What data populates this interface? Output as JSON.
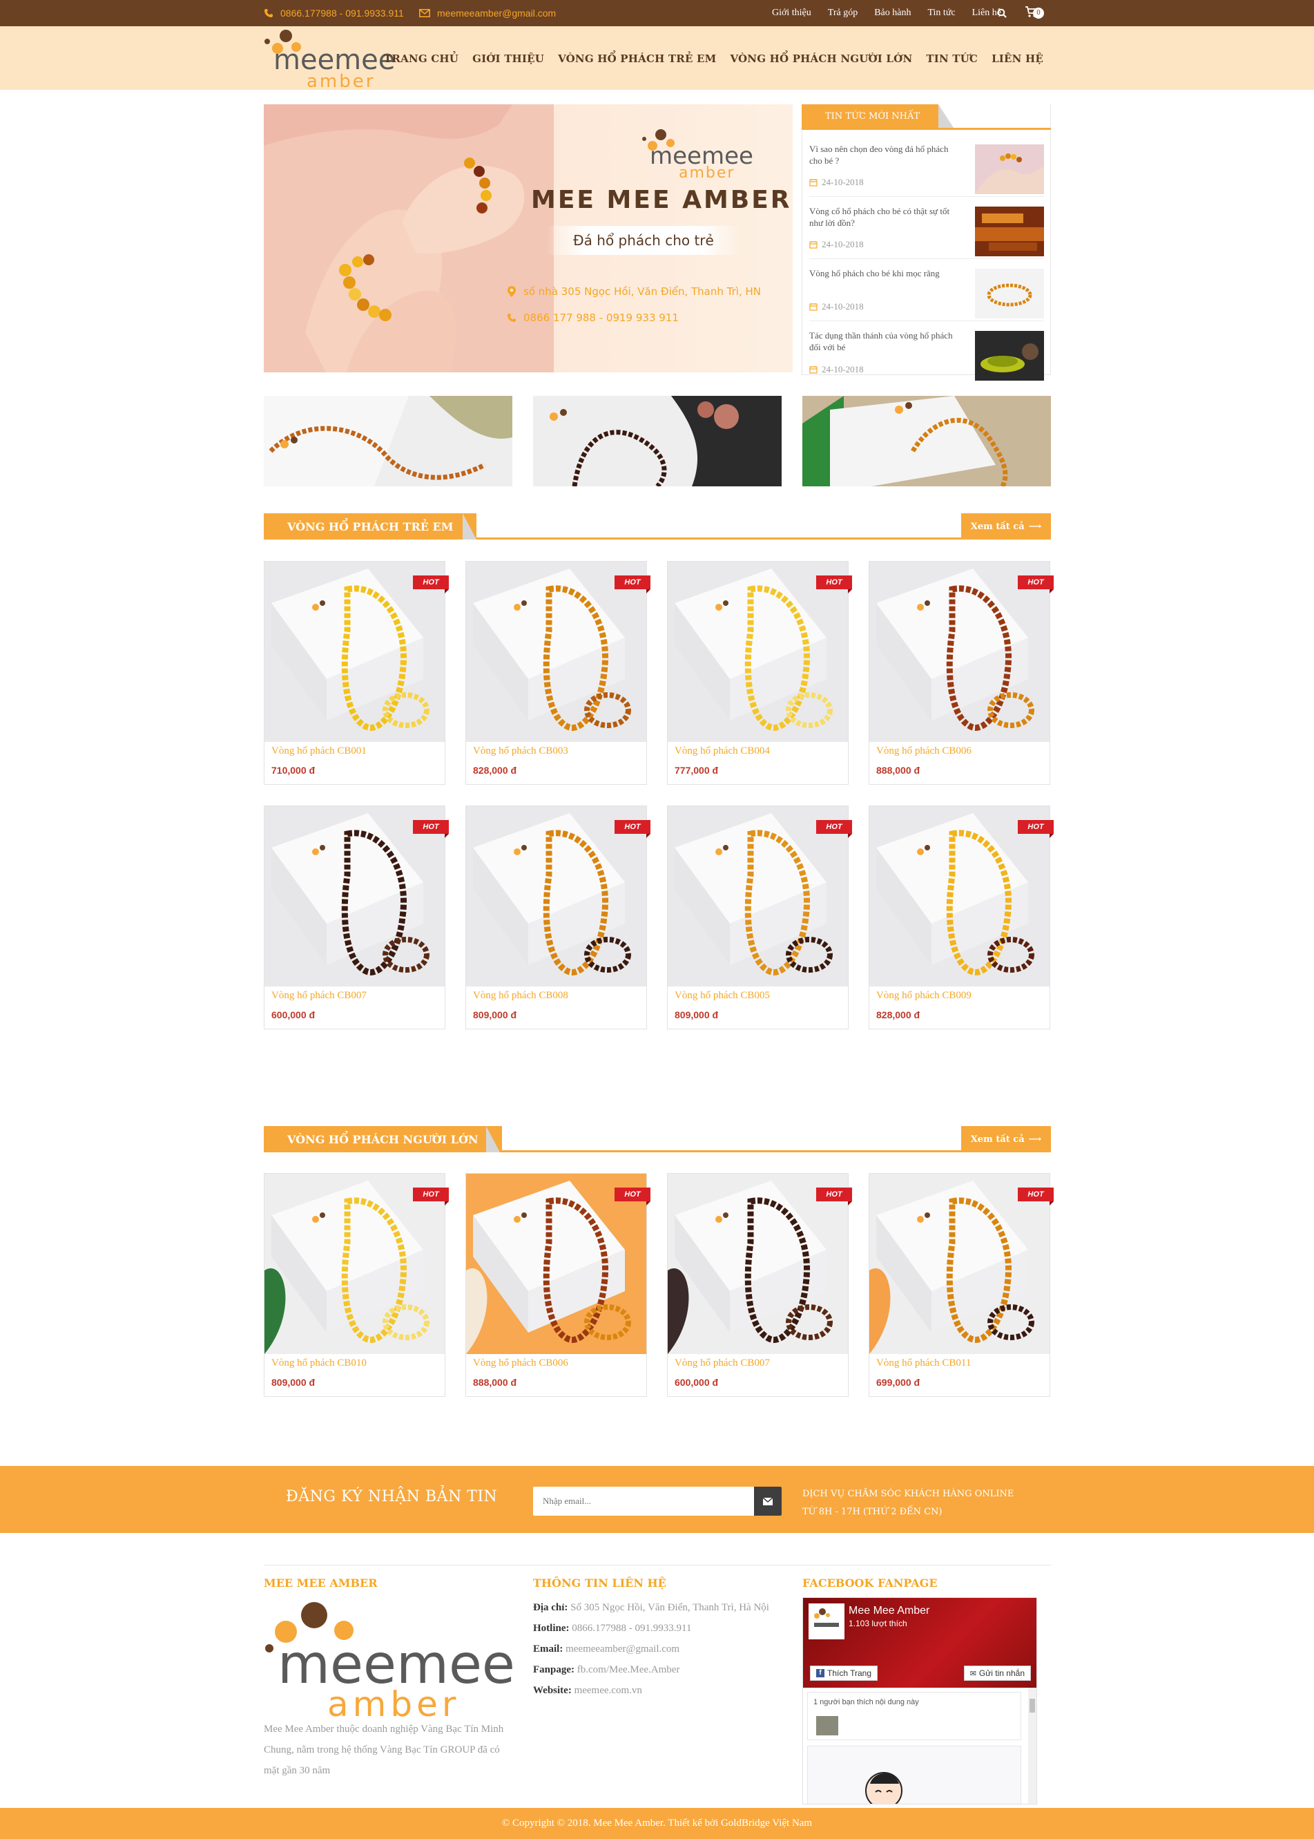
{
  "topbar": {
    "phone": "0866.177988 - 091.9933.911",
    "email": "meemeeamber@gmail.com",
    "links": [
      "Giới thiệu",
      "Trả góp",
      "Bảo hành",
      "Tin tức",
      "Liên hệ"
    ],
    "cart_count": "0"
  },
  "logo": {
    "line1": "meemee",
    "line2": "amber"
  },
  "nav": [
    "TRANG CHỦ",
    "GIỚI THIỆU",
    "VÒNG HỔ PHÁCH TRẺ EM",
    "VÒNG HỔ PHÁCH NGƯỜI LỚN",
    "TIN TỨC",
    "LIÊN HỆ"
  ],
  "banner": {
    "logo_line1": "meemee",
    "logo_line2": "amber",
    "title": "MEE MEE AMBER",
    "subtitle": "Đá hổ phách cho trẻ",
    "address": "số nhà 305 Ngọc Hồi, Văn Điển, Thanh Trì, HN",
    "phone": "0866 177 988 - 0919 933 911"
  },
  "news": {
    "heading": "TIN TỨC MỚI NHẤT",
    "items": [
      {
        "title": "Vì sao nên chọn đeo vòng đá hổ phách cho bé ?",
        "date": "24-10-2018"
      },
      {
        "title": "Vòng cổ hổ phách cho bé có thật sự tốt như lời đồn?",
        "date": "24-10-2018"
      },
      {
        "title": "Vòng hổ phách cho bé khi mọc răng",
        "date": "24-10-2018"
      },
      {
        "title": "Tác dụng thần thánh của vòng hổ phách đối với bé",
        "date": "24-10-2018"
      }
    ]
  },
  "section_kids": {
    "title": "VÒNG HỔ PHÁCH TRẺ EM",
    "more": "Xem tất cả",
    "products": [
      {
        "name": "Vòng hổ phách CB001",
        "price": "710,000 đ",
        "badge": "HOT"
      },
      {
        "name": "Vòng hổ phách CB003",
        "price": "828,000 đ",
        "badge": "HOT"
      },
      {
        "name": "Vòng hổ phách CB004",
        "price": "777,000 đ",
        "badge": "HOT"
      },
      {
        "name": "Vòng hổ phách CB006",
        "price": "888,000 đ",
        "badge": "HOT"
      },
      {
        "name": "Vòng hổ phách CB007",
        "price": "600,000 đ",
        "badge": "HOT"
      },
      {
        "name": "Vòng hổ phách CB008",
        "price": "809,000 đ",
        "badge": "HOT"
      },
      {
        "name": "Vòng hổ phách CB005",
        "price": "809,000 đ",
        "badge": "HOT"
      },
      {
        "name": "Vòng hổ phách CB009",
        "price": "828,000 đ",
        "badge": "HOT"
      }
    ]
  },
  "section_adult": {
    "title": "VÒNG HỔ PHÁCH NGƯỜI LỚN",
    "more": "Xem tất cả",
    "products": [
      {
        "name": "Vòng hổ phách CB010",
        "price": "809,000 đ",
        "badge": "HOT"
      },
      {
        "name": "Vòng hổ phách CB006",
        "price": "888,000 đ",
        "badge": "HOT"
      },
      {
        "name": "Vòng hổ phách CB007",
        "price": "600,000 đ",
        "badge": "HOT"
      },
      {
        "name": "Vòng hổ phách CB011",
        "price": "699,000 đ",
        "badge": "HOT"
      }
    ]
  },
  "newsletter": {
    "title": "ĐĂNG KÝ NHẬN BẢN TIN",
    "placeholder": "Nhập email...",
    "service_line1": "DỊCH VỤ CHĂM SÓC KHÁCH HÀNG ONLINE",
    "service_line2": "TỪ 8H - 17H (THỨ 2 ĐẾN CN)"
  },
  "footer": {
    "about_title": "MEE MEE AMBER",
    "about_text": "Mee Mee Amber thuộc doanh nghiệp Vàng Bạc Tín Minh Chung, nằm trong hệ thống Vàng Bạc Tín GROUP đã có mặt gần 30 năm",
    "contact_title": "THÔNG TIN LIÊN HỆ",
    "address_label": "Địa chỉ:",
    "address": "Số 305 Ngọc Hồi, Văn Điển, Thanh Trì, Hà Nội",
    "hotline_label": "Hotline:",
    "hotline": "0866.177988 - 091.9933.911",
    "email_label": "Email:",
    "email": "meemeeamber@gmail.com",
    "fanpage_label": "Fanpage:",
    "fanpage": "fb.com/Mee.Mee.Amber",
    "website_label": "Website:",
    "website": "meemee.com.vn",
    "fb_title": "FACEBOOK FANPAGE",
    "fb_page_name": "Mee Mee Amber",
    "fb_likes": "1.103 lượt thích",
    "fb_like_btn": "Thích Trang",
    "fb_msg_btn": "Gửi tin nhắn",
    "fb_friend": "1 người bạn thích nội dung này",
    "copyright": "© Copyright © 2018. Mee Mee Amber. Thiết kế bởi GoldBridge Việt Nam"
  },
  "colors": {
    "brown": "#6b4124",
    "orange": "#f7a83a",
    "cream": "#fde5c3",
    "hot_red": "#d81f26",
    "price_red": "#c0392b"
  }
}
